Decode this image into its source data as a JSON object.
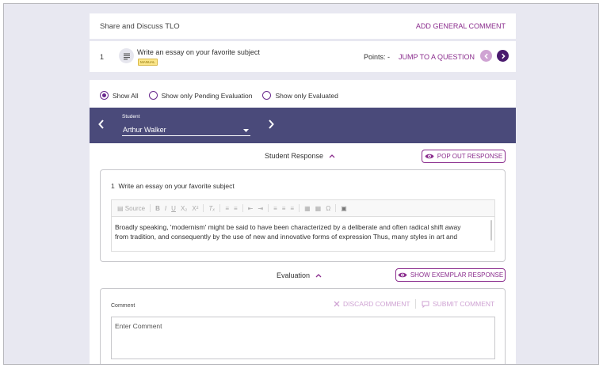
{
  "header": {
    "title": "Share and Discuss TLO",
    "add_comment": "ADD GENERAL COMMENT"
  },
  "question": {
    "number": "1",
    "title": "Write an essay on your favorite subject",
    "badge": "MANUAL",
    "points_label": "Points: -",
    "jump": "JUMP TO A QUESTION"
  },
  "filters": {
    "all": "Show All",
    "pending": "Show only Pending Evaluation",
    "evaluated": "Show only Evaluated",
    "selected": "all"
  },
  "student": {
    "label": "Student",
    "name": "Arthur Walker"
  },
  "response": {
    "header": "Student Response",
    "popout": "POP OUT RESPONSE",
    "question_line": "1  Write an essay on your favorite subject",
    "toolbar_source": "Source",
    "text_line1": "Broadly speaking, 'modernism' might be said to have been characterized by a deliberate and often radical shift away",
    "text_line2": "from tradition, and consequently by the use of new and innovative forms of expression Thus, many styles in art and"
  },
  "evaluation": {
    "header": "Evaluation",
    "exemplar": "SHOW EXEMPLAR RESPONSE",
    "comment_label": "Comment",
    "discard": "DISCARD COMMENT",
    "submit": "SUBMIT COMMENT",
    "comment_placeholder": "Enter Comment"
  },
  "colors": {
    "accent": "#8b2e8e",
    "banner": "#4a4a7a",
    "background": "#e8e8f1"
  }
}
